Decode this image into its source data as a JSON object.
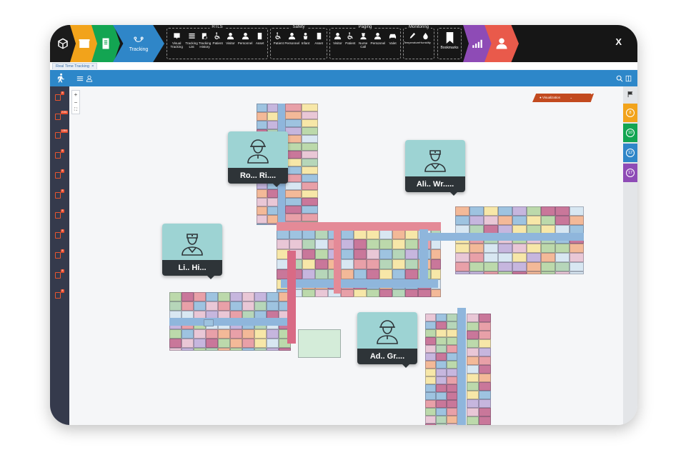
{
  "ribbon": {
    "tracking_label": "Tracking",
    "close_label": "X",
    "groups": [
      {
        "title": "RTLS",
        "items": [
          "Visual Tracking",
          "Tracking List",
          "Tracking History",
          "Patient",
          "Visitor",
          "Personnel",
          "Asset"
        ]
      },
      {
        "title": "Safety",
        "items": [
          "Patient",
          "Personnel",
          "Infant",
          "Asset"
        ]
      },
      {
        "title": "Paging",
        "items": [
          "Visitor",
          "Patient",
          "Nurse Call",
          "Personnel",
          "Valet"
        ]
      },
      {
        "title": "Monitoring",
        "items": [
          "Temperature",
          "Humidity"
        ]
      }
    ],
    "bookmarks_label": "Bookmarks",
    "colors": {
      "cube": "#1b1b1b",
      "box": "#f2a31b",
      "doc": "#13a552",
      "tracking": "#2f86c8",
      "chart": "#8e4bb6",
      "user": "#e95a4b"
    }
  },
  "tab": {
    "label": "Real Time Tracking",
    "close": "×"
  },
  "map": {
    "zoom_in": "+",
    "zoom_out": "−",
    "visualization_label": "● Visualization",
    "visualization_caret": "⌄"
  },
  "left_badges": [
    "8",
    "2151",
    "1384",
    "8",
    "8",
    "8",
    "8",
    "8",
    "8",
    "8",
    "8"
  ],
  "right_counters": [
    {
      "value": "8",
      "color": "#f2a31b"
    },
    {
      "value": "10",
      "color": "#13a552"
    },
    {
      "value": "12",
      "color": "#2f86c8"
    },
    {
      "value": "17",
      "color": "#8e4bb6"
    }
  ],
  "people": [
    {
      "name": "Ro... Ri....",
      "role": "worker"
    },
    {
      "name": "Ali.. Wr.....",
      "role": "nurse"
    },
    {
      "name": "Li.. Hi...",
      "role": "nurse"
    },
    {
      "name": "Ad.. Gr....",
      "role": "worker"
    }
  ]
}
